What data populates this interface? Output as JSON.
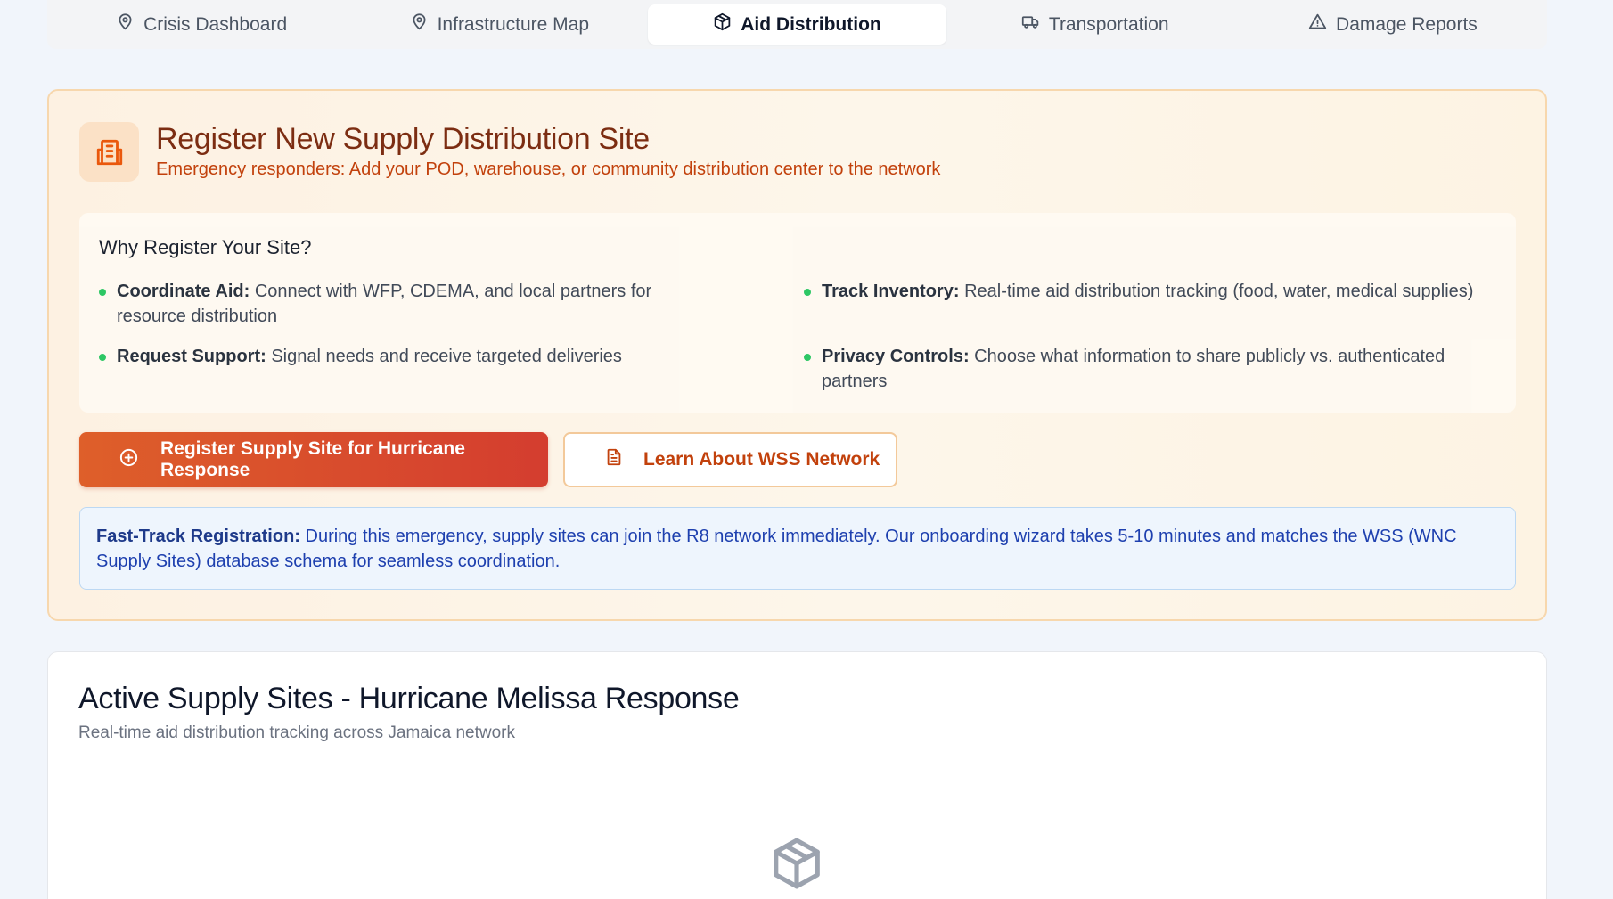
{
  "tabs": [
    {
      "label": "Crisis Dashboard",
      "icon": "map-pin-icon"
    },
    {
      "label": "Infrastructure Map",
      "icon": "map-pin-icon"
    },
    {
      "label": "Aid Distribution",
      "icon": "package-icon",
      "active": true
    },
    {
      "label": "Transportation",
      "icon": "truck-icon"
    },
    {
      "label": "Damage Reports",
      "icon": "alert-triangle-icon"
    }
  ],
  "register": {
    "icon": "building-icon",
    "title": "Register New Supply Distribution Site",
    "subtitle": "Emergency responders: Add your POD, warehouse, or community distribution center to the network",
    "why_title": "Why Register Your Site?",
    "benefits": [
      {
        "label": "Coordinate Aid:",
        "text": "Connect with WFP, CDEMA, and local partners for resource distribution"
      },
      {
        "label": "Track Inventory:",
        "text": "Real-time aid distribution tracking (food, water, medical supplies)"
      },
      {
        "label": "Request Support:",
        "text": "Signal needs and receive targeted deliveries"
      },
      {
        "label": "Privacy Controls:",
        "text": "Choose what information to share publicly vs. authenticated partners"
      }
    ],
    "primary_button": "Register Supply Site for Hurricane Response",
    "secondary_button": "Learn About WSS Network",
    "info_label": "Fast-Track Registration:",
    "info_text": "During this emergency, supply sites can join the R8 network immediately. Our onboarding wizard takes 5-10 minutes and matches the WSS (WNC Supply Sites) database schema for seamless coordination."
  },
  "sites": {
    "title": "Active Supply Sites - Hurricane Melissa Response",
    "subtitle": "Real-time aid distribution tracking across Jamaica network",
    "empty_icon": "package-icon"
  },
  "colors": {
    "accent": "#ea580c",
    "primary_button": "#d94a2c",
    "benefit_bullet": "#22c55e",
    "info_text": "#1e40af"
  }
}
